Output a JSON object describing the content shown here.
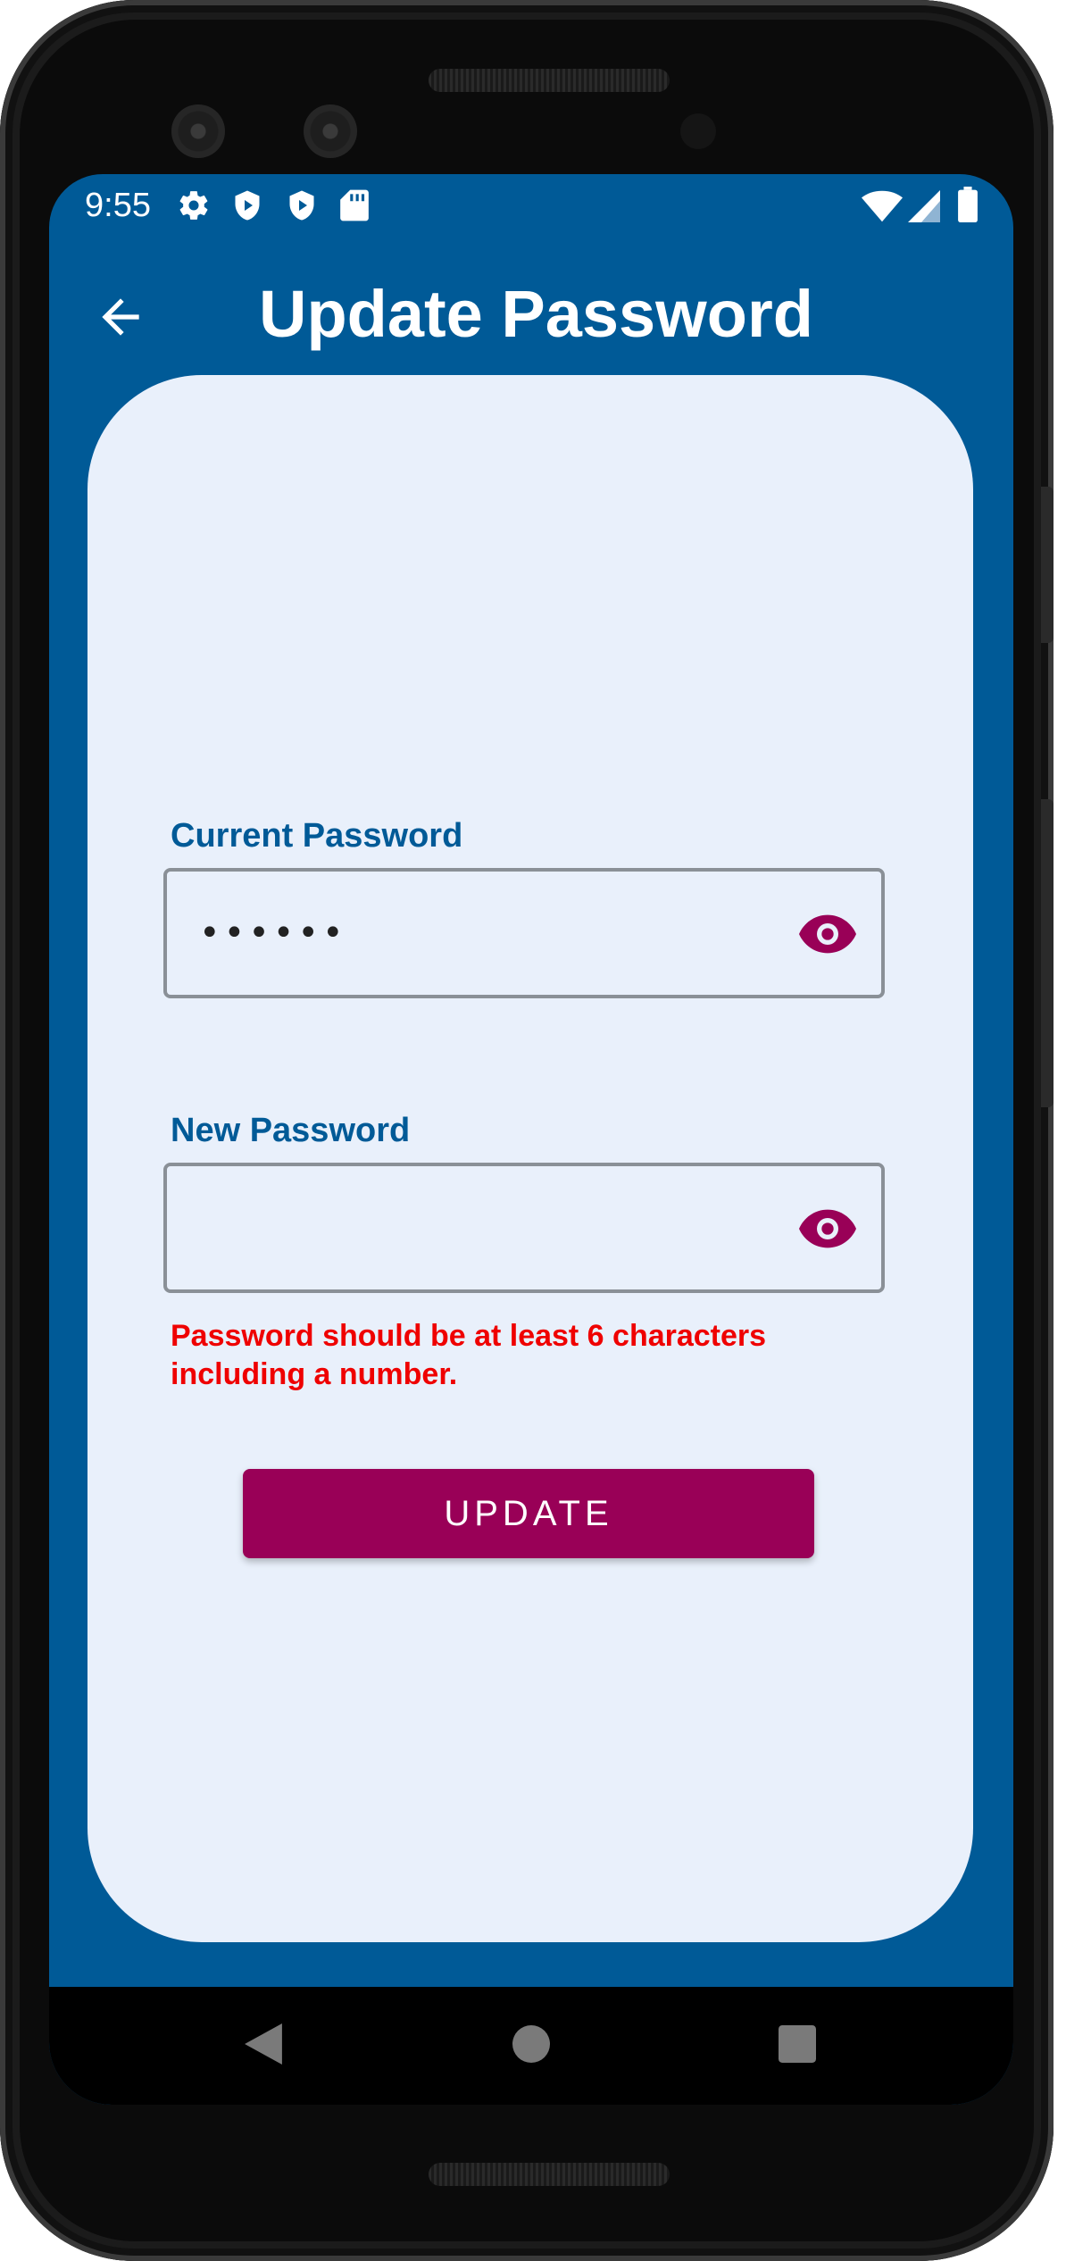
{
  "status_bar": {
    "time": "9:55",
    "left_icons": [
      "gear-icon",
      "shield-play-icon",
      "shield-play-icon",
      "sd-card-icon"
    ],
    "right_icons": [
      "wifi-icon",
      "cellular-signal-icon",
      "battery-icon"
    ]
  },
  "app_bar": {
    "title": "Update Password",
    "back_icon": "arrow-back-icon"
  },
  "form": {
    "current_password": {
      "label": "Current Password",
      "value": "••••••",
      "toggle_icon": "eye-icon"
    },
    "new_password": {
      "label": "New Password",
      "value": "",
      "toggle_icon": "eye-icon"
    },
    "error": "Password should be at least 6 characters including a number.",
    "submit_label": "UPDATE"
  },
  "nav_bar": {
    "buttons": [
      "back-triangle-icon",
      "home-circle-icon",
      "recents-square-icon"
    ]
  },
  "colors": {
    "primary": "#005a97",
    "card_background": "#e9f0fb",
    "accent": "#990057",
    "error": "#ef0000",
    "field_border": "#8a9097"
  }
}
